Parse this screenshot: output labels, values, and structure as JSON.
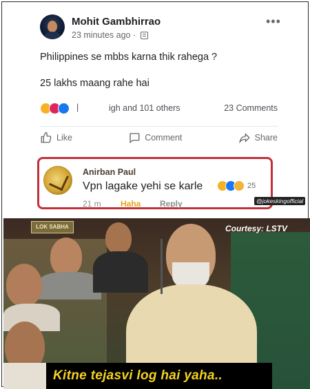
{
  "post": {
    "author": "Mohit Gambhirrao",
    "time": "23 minutes ago ·",
    "line1": "Philippines se mbbs karna thik rahega ?",
    "line2": "25 lakhs maang rahe hai",
    "more": "•••"
  },
  "reactions": {
    "summary": "igh and 101 others",
    "comments": "23 Comments",
    "icons": [
      "haha-icon",
      "wow-icon",
      "like-icon"
    ]
  },
  "actions": {
    "like": "Like",
    "comment": "Comment",
    "share": "Share"
  },
  "comment": {
    "name": "Anirban Paul",
    "text": "Vpn lagake yehi se karle",
    "react_count": "25",
    "time": "21 m",
    "haha": "Haha",
    "reply": "Reply"
  },
  "watermark": "@jokeskingofficial",
  "video": {
    "channel_logo": "LOK SABHA",
    "courtesy": "Courtesy: LSTV",
    "subtitle": "Kitne tejasvi log hai yaha.."
  },
  "colors": {
    "highlight_border": "#c0303a",
    "haha_label": "#e3a51d",
    "subtitle_text": "#f5d322"
  }
}
